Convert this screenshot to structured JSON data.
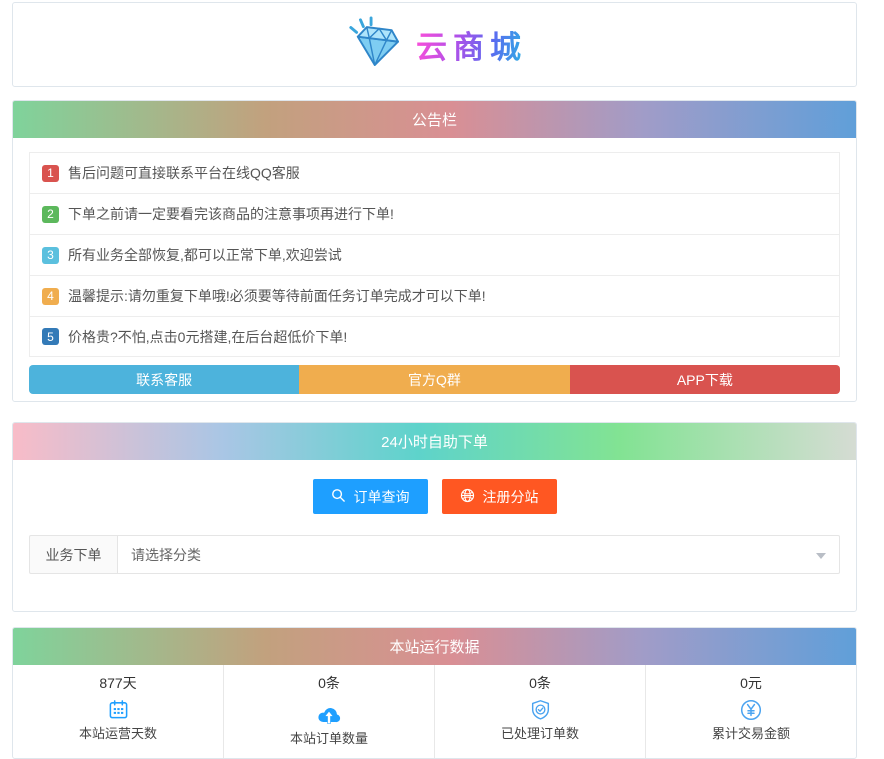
{
  "logo": {
    "title": "云商城"
  },
  "notice": {
    "header": "公告栏",
    "items": [
      {
        "num": "1",
        "text": "售后问题可直接联系平台在线QQ客服",
        "color": "#d9534f"
      },
      {
        "num": "2",
        "text": "下单之前请一定要看完该商品的注意事项再进行下单!",
        "color": "#5cb85c"
      },
      {
        "num": "3",
        "text": "所有业务全部恢复,都可以正常下单,欢迎尝试",
        "color": "#5bc0de"
      },
      {
        "num": "4",
        "text": "温馨提示:请勿重复下单哦!必须要等待前面任务订单完成才可以下单!",
        "color": "#f0ad4e"
      },
      {
        "num": "5",
        "text": "价格贵?不怕,点击0元搭建,在后台超低价下单!",
        "color": "#337ab7"
      }
    ],
    "buttons": [
      {
        "label": "联系客服",
        "color": "#4db3dc"
      },
      {
        "label": "官方Q群",
        "color": "#f0ad4e"
      },
      {
        "label": "APP下载",
        "color": "#d9534f"
      }
    ]
  },
  "order": {
    "header": "24小时自助下单",
    "query_button": {
      "label": "订单查询",
      "color": "#1E9FFF"
    },
    "register_button": {
      "label": "注册分站",
      "color": "#FF5722"
    },
    "form_label": "业务下单",
    "select_placeholder": "请选择分类"
  },
  "stats": {
    "header": "本站运行数据",
    "accent_color": "#1E9FFF",
    "items": [
      {
        "value": "877天",
        "label": "本站运营天数",
        "icon": "calendar-icon"
      },
      {
        "value": "0条",
        "label": "本站订单数量",
        "icon": "cloud-upload-icon"
      },
      {
        "value": "0条",
        "label": "已处理订单数",
        "icon": "shield-check-icon"
      },
      {
        "value": "0元",
        "label": "累计交易金额",
        "icon": "yen-circle-icon"
      }
    ]
  }
}
